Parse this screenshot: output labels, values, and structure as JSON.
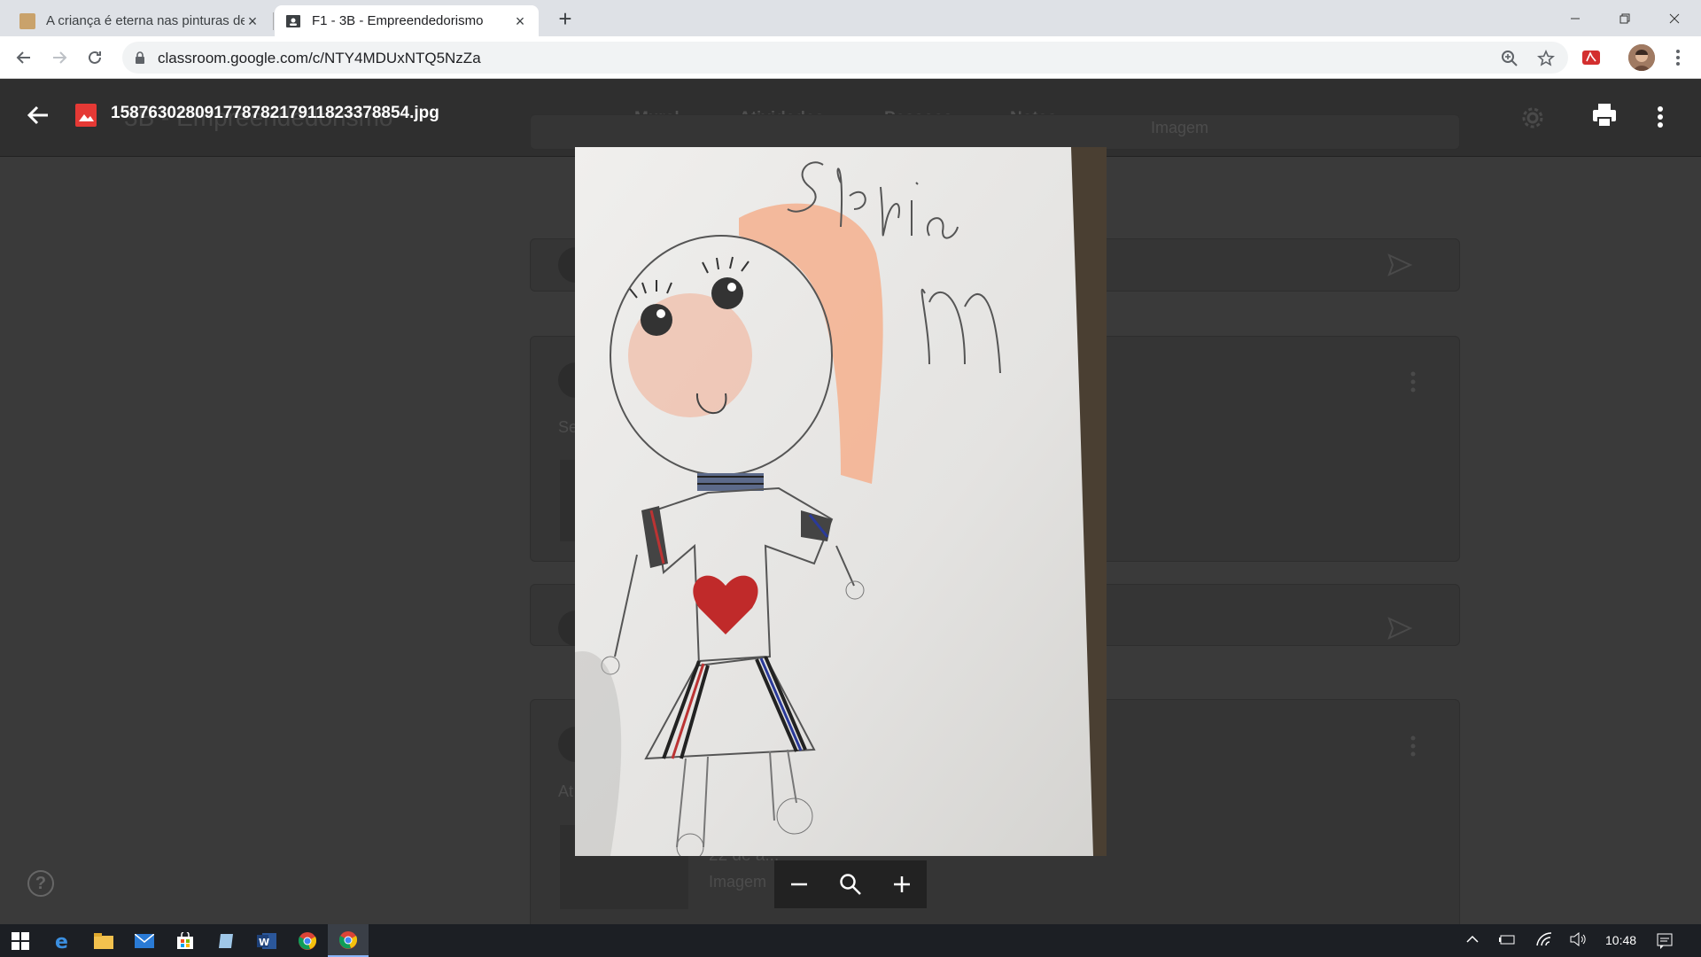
{
  "browser": {
    "tabs": [
      {
        "title": "A criança é eterna nas pinturas de",
        "active": false
      },
      {
        "title": "F1 - 3B - Empreendedorismo",
        "active": true
      }
    ],
    "url": "classroom.google.com/c/NTY4MDUxNTQ5NzZa"
  },
  "background_page": {
    "course_title": "3B - Empreendedorismo",
    "nav": [
      "Mural",
      "Atividades",
      "Pessoas",
      "Notas"
    ],
    "attachment_label_top": "Imagem",
    "post_text_1": "Se",
    "post_text_2": "At",
    "attachment_title_bottom": "22 de a...",
    "attachment_label_bottom": "Imagem"
  },
  "viewer": {
    "file_name": "15876302809177878217911823378854.jpg",
    "drawing_signature": "Sophia M"
  },
  "help": {
    "label": "?"
  },
  "taskbar": {
    "clock": "10:48"
  },
  "colors": {
    "viewer_overlay": "#2b2b2b",
    "file_icon": "#e53935",
    "taskbar": "#1c1f24"
  }
}
